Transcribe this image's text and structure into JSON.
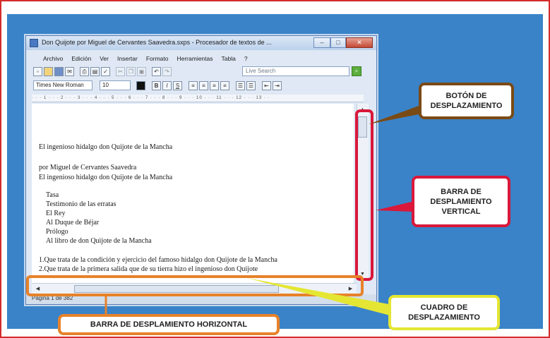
{
  "window": {
    "title": "Don Quijote por Miguel de Cervantes Saavedra.sxps - Procesador de textos de ...",
    "buttons": {
      "minimize": "‒",
      "maximize": "□",
      "close": "✕"
    }
  },
  "menu": [
    "Archivo",
    "Edición",
    "Ver",
    "Insertar",
    "Formato",
    "Herramientas",
    "Tabla",
    "?"
  ],
  "toolbar": {
    "search_placeholder": "Live Search",
    "icons": [
      "new-document-icon",
      "open-folder-icon",
      "save-icon",
      "email-icon",
      "print-icon",
      "print-preview-icon",
      "spellcheck-icon",
      "cut-icon",
      "copy-icon",
      "paste-icon",
      "undo-icon",
      "redo-icon"
    ]
  },
  "format": {
    "font": "Times New Roman",
    "size": "10"
  },
  "ruler": "· · · 1 · · · 2 · · · 3 · · · 4 · · · 5 · · · 6 · · · 7 · · · 8 · · · 9 · · · 10 · · · 11 · · · 12 · · · 13 · ·",
  "document": {
    "lines": [
      "El ingenioso hidalgo don Quijote de la Mancha",
      "por Miguel de Cervantes Saavedra",
      "El ingenioso hidalgo don Quijote de la Mancha",
      "Tasa",
      "Testimonio de las erratas",
      "El Rey",
      "Al Duque de Béjar",
      "Prólogo",
      "Al libro de don Quijote de la Mancha",
      "1.Que trata de la condición y ejercicio del famoso hidalgo don Quijote de la Mancha",
      "2.Que trata de la primera salida que de su tierra hizo el ingenioso don Quijote"
    ]
  },
  "status": "Página 1 de 382",
  "callouts": {
    "boton": "BOTÓN DE\nDESPLAZAMIENTO",
    "barra_vertical": "BARRA DE\nDESPLAMIENTO\nVERTICAL",
    "cuadro": "CUADRO DE\nDESPLAZAMIENTO",
    "barra_horizontal": "BARRA DE DESPLAMIENTO HORIZONTAL"
  },
  "colors": {
    "frame": "#d42a2a",
    "background": "#3a83c8",
    "vertical_highlight": "#d9183a",
    "horizontal_highlight": "#e7822a",
    "boton_border": "#7a4a15",
    "cuadro_border": "#e4e633"
  }
}
